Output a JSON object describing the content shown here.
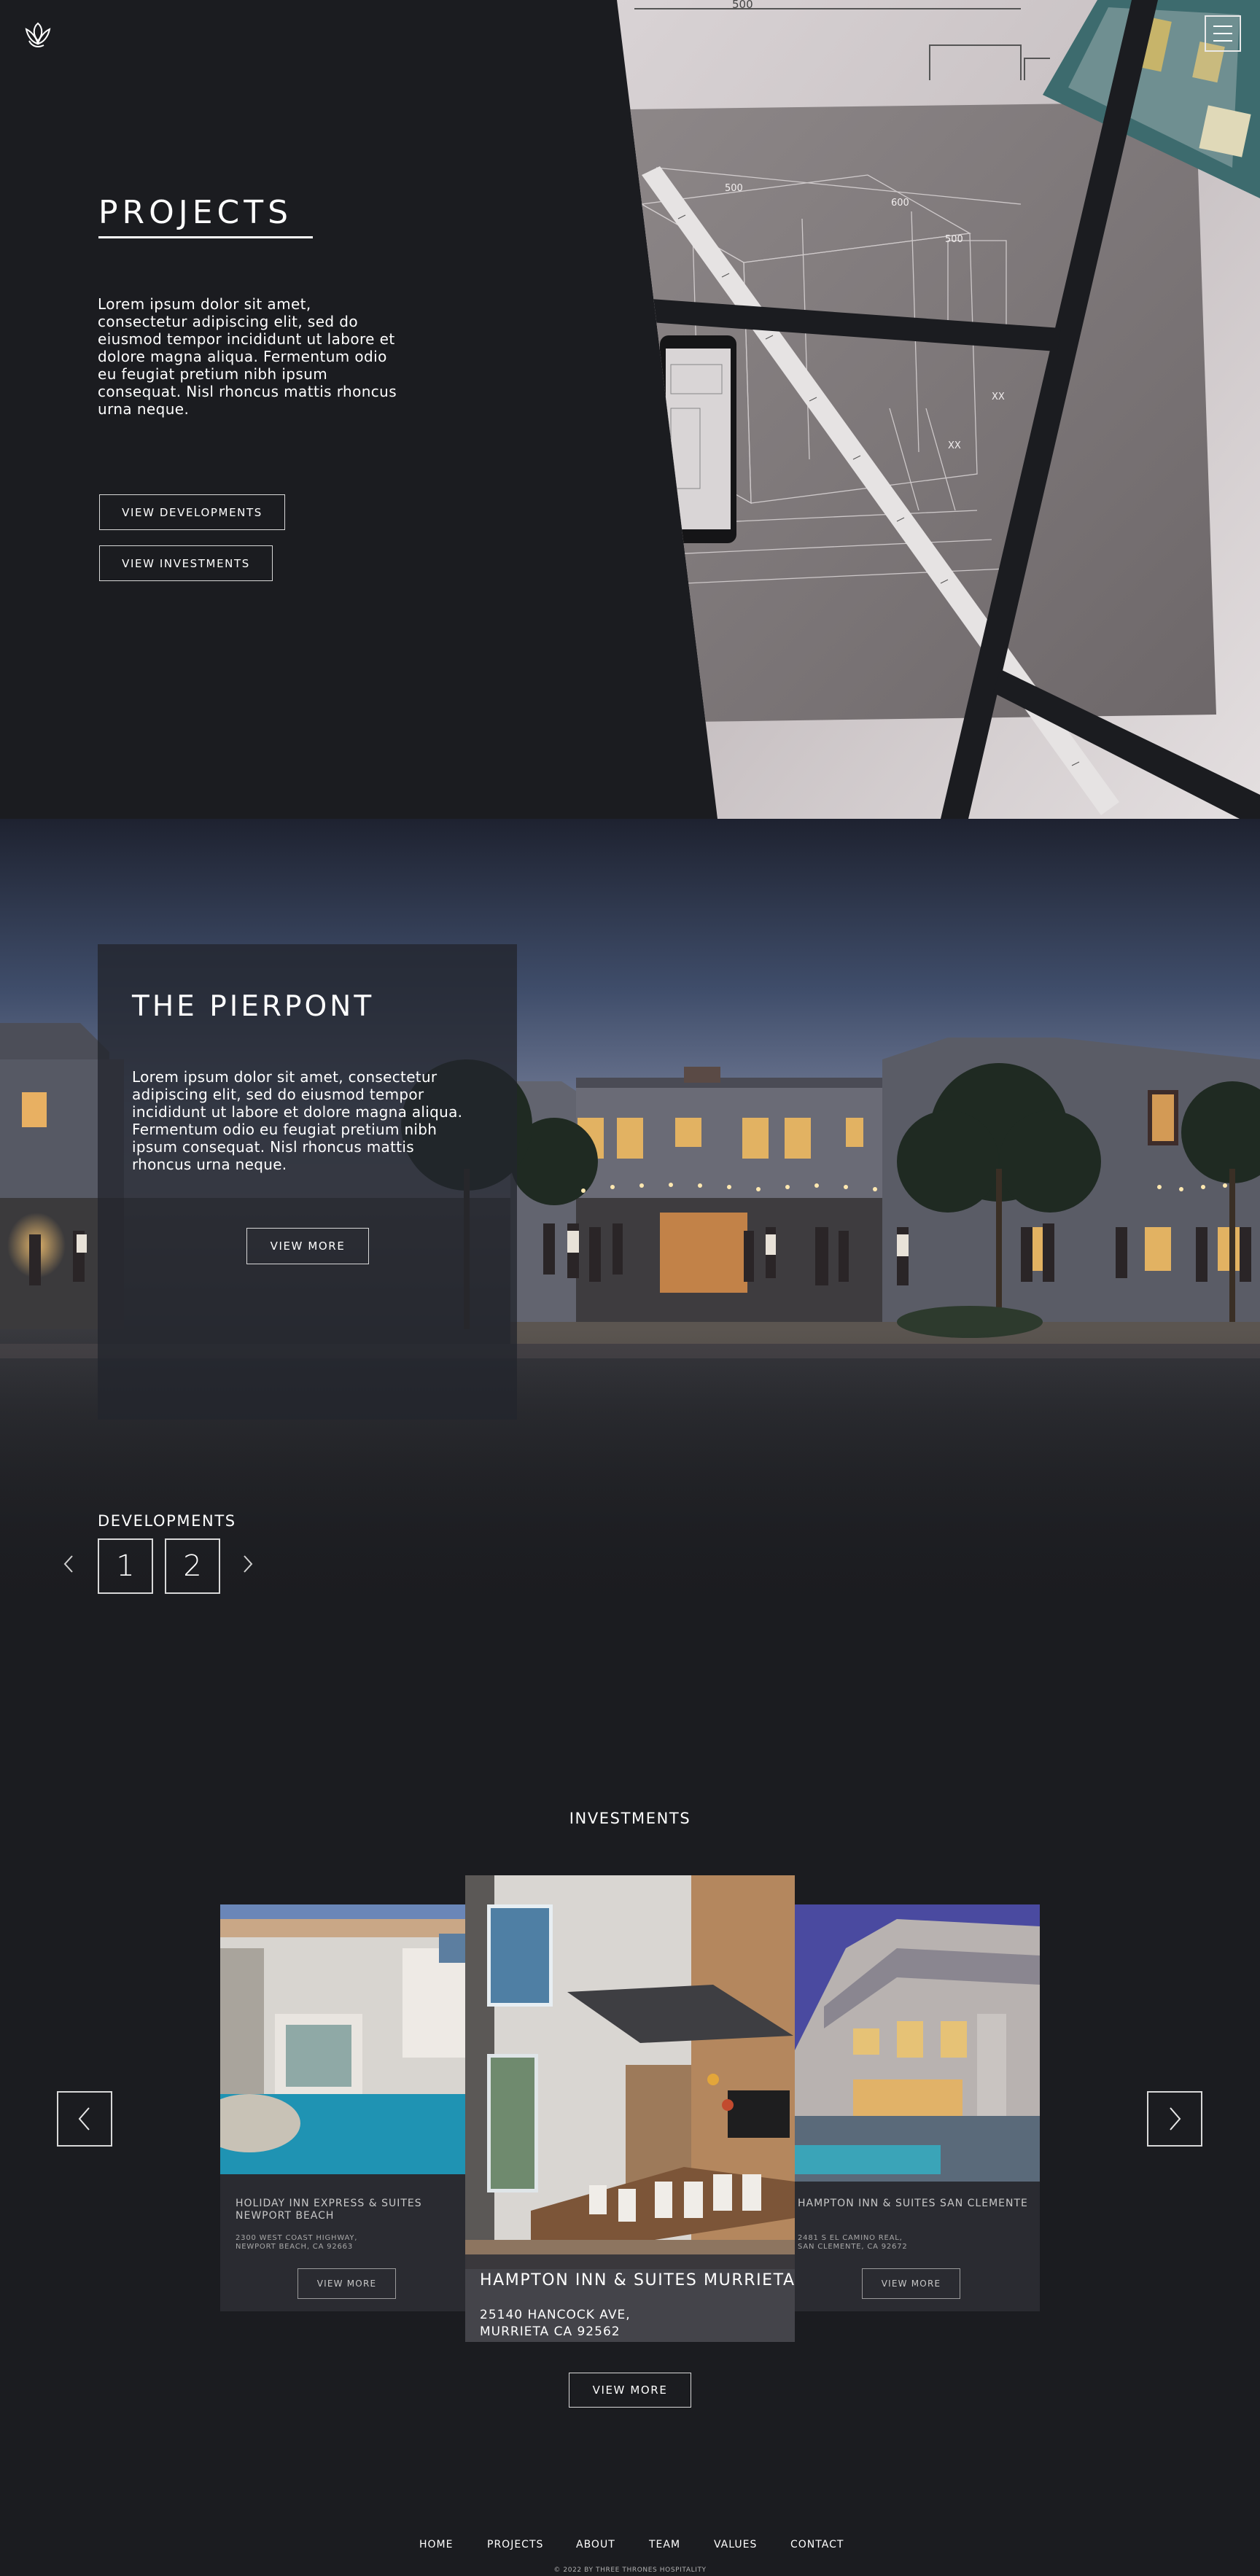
{
  "header": {
    "logo_icon": "lotus-logo-icon",
    "menu_icon": "hamburger-menu-icon"
  },
  "hero": {
    "title": "PROJECTS",
    "text": "Lorem ipsum dolor sit amet, consectetur adipiscing elit, sed do eiusmod tempor incididunt ut labore et dolore magna aliqua. Fermentum odio eu feugiat pretium nibh ipsum consequat. Nisl rhoncus mattis rhoncus urna neque.",
    "view_developments_label": "VIEW DEVELOPMENTS",
    "view_investments_label": "VIEW INVESTMENTS",
    "blueprint_labels": [
      "500",
      "500",
      "600",
      "500",
      "XX",
      "XX"
    ]
  },
  "development": {
    "title": "THE PIERPONT",
    "text": "Lorem ipsum dolor sit amet, consectetur adipiscing elit, sed do eiusmod tempor incididunt ut labore et dolore magna aliqua. Fermentum odio eu feugiat pretium nibh ipsum consequat. Nisl rhoncus mattis rhoncus urna neque.",
    "view_more_label": "VIEW MORE"
  },
  "developments_pager": {
    "label": "DEVELOPMENTS",
    "prev_icon": "chevron-left-icon",
    "next_icon": "chevron-right-icon",
    "pages": [
      "1",
      "2"
    ]
  },
  "investments": {
    "label": "INVESTMENTS",
    "cards": [
      {
        "name": "HOLIDAY INN EXPRESS & SUITES NEWPORT BEACH",
        "address_line1": "2300 WEST COAST HIGHWAY,",
        "address_line2": "NEWPORT BEACH, CA 92663",
        "button_label": "VIEW MORE"
      },
      {
        "name": "HAMPTON INN & SUITES MURRIETA",
        "address_line1": "25140 HANCOCK AVE,",
        "address_line2": "MURRIETA CA 92562"
      },
      {
        "name": "HAMPTON INN & SUITES SAN CLEMENTE",
        "address_line1": "2481 S EL CAMINO REAL,",
        "address_line2": "SAN CLEMENTE, CA 92672",
        "button_label": "VIEW MORE"
      }
    ],
    "prev_icon": "chevron-left-icon",
    "next_icon": "chevron-right-icon",
    "view_more_label": "VIEW MORE"
  },
  "footer": {
    "nav": [
      "HOME",
      "PROJECTS",
      "ABOUT",
      "TEAM",
      "VALUES",
      "CONTACT"
    ],
    "copyright": "© 2022 BY THREE THRONES HOSPITALITY"
  },
  "colors": {
    "background": "#1b1c20",
    "card_overlay": "#23252d",
    "text": "#ffffff"
  }
}
